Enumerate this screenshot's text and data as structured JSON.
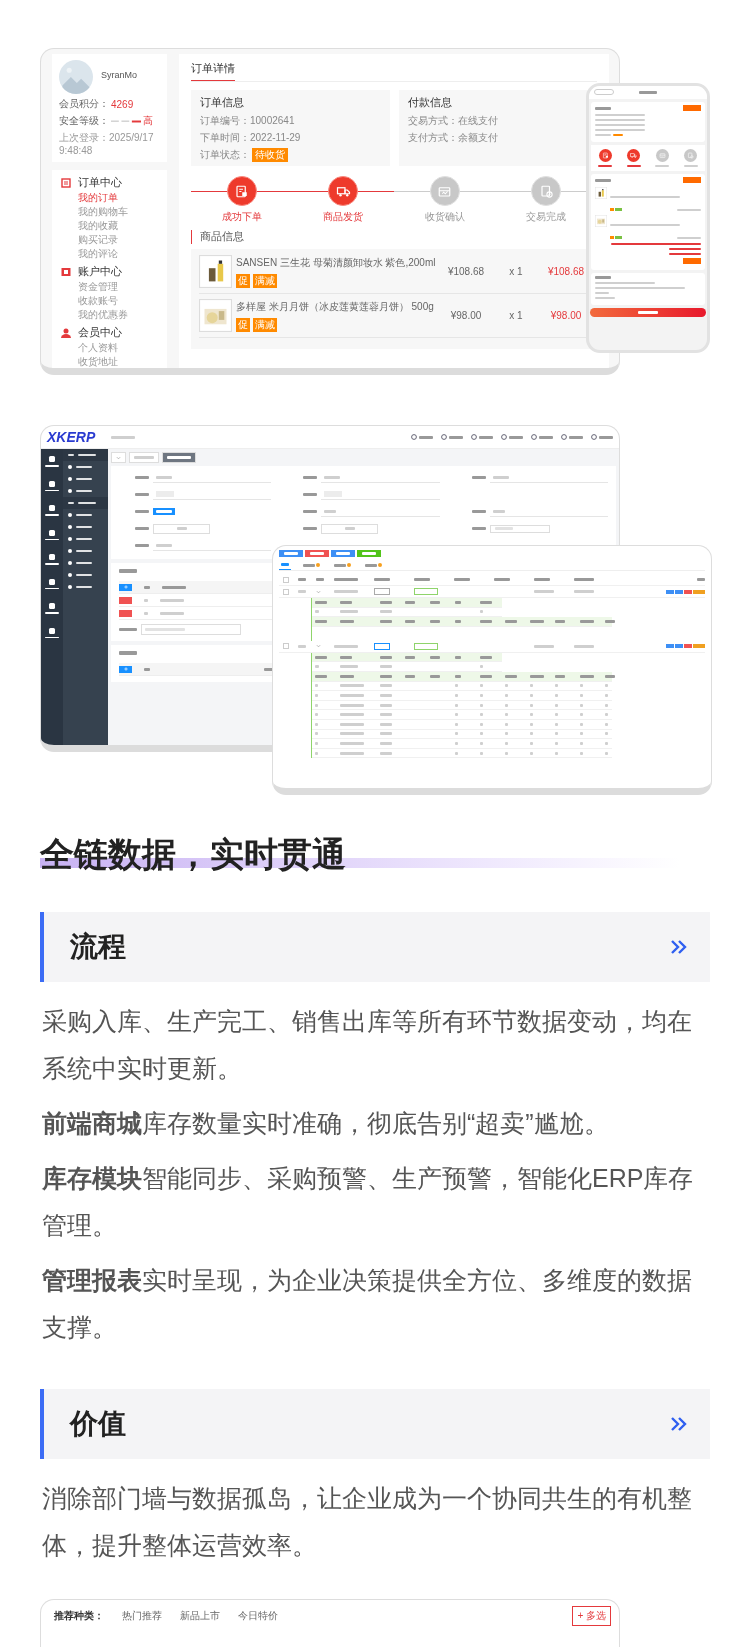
{
  "order_screen": {
    "user": {
      "name": "SyranMo",
      "points_label": "会员积分：",
      "points": "4269",
      "security_label": "安全等级：",
      "security_level": "高",
      "last_login": "上次登录：2025/9/17 9:48:48"
    },
    "menu": [
      {
        "title": "订单中心",
        "items": [
          {
            "label": "我的订单",
            "selected": true
          },
          {
            "label": "我的购物车",
            "selected": false
          },
          {
            "label": "我的收藏",
            "selected": false
          },
          {
            "label": "购买记录",
            "selected": false
          },
          {
            "label": "我的评论",
            "selected": false
          }
        ]
      },
      {
        "title": "账户中心",
        "items": [
          {
            "label": "资金管理",
            "selected": false
          },
          {
            "label": "收款账号",
            "selected": false
          },
          {
            "label": "我的优惠券",
            "selected": false
          }
        ]
      },
      {
        "title": "会员中心",
        "items": [
          {
            "label": "个人资料",
            "selected": false
          },
          {
            "label": "收货地址",
            "selected": false
          }
        ]
      }
    ],
    "tab": "订单详情",
    "order_info": {
      "title": "订单信息",
      "lines": [
        "订单编号：10002641",
        "下单时间：2022-11-29"
      ],
      "status_label": "订单状态：",
      "status": "待收货"
    },
    "payment_info": {
      "title": "付款信息",
      "lines": [
        "交易方式：在线支付",
        "支付方式：余额支付"
      ]
    },
    "steps": [
      {
        "label": "成功下单",
        "done": true
      },
      {
        "label": "商品发货",
        "done": true
      },
      {
        "label": "收货确认",
        "done": false
      },
      {
        "label": "交易完成",
        "done": false
      }
    ],
    "goods_title": "商品信息",
    "goods": [
      {
        "name": "SANSEN 三生花 母菊清颜卸妆水 紫色,200ml",
        "tags": [
          "促",
          "满减"
        ],
        "price": "¥108.68",
        "qty": "x 1",
        "total": "¥108.68"
      },
      {
        "name": "多样屋 米月月饼（冰皮莲黄莲蓉月饼） 500g",
        "tags": [
          "促",
          "满减"
        ],
        "price": "¥98.00",
        "qty": "x 1",
        "total": "¥98.00"
      }
    ]
  },
  "mobile_screen": {
    "steps": [
      {
        "done": true
      },
      {
        "done": true
      },
      {
        "done": false
      },
      {
        "done": false
      }
    ]
  },
  "erp_screen": {
    "logo": "XKERP",
    "menu": [
      {
        "kind": "group"
      },
      {
        "kind": "item"
      },
      {
        "kind": "item"
      },
      {
        "kind": "item"
      },
      {
        "kind": "group"
      },
      {
        "kind": "item"
      },
      {
        "kind": "item"
      },
      {
        "kind": "item"
      },
      {
        "kind": "item"
      },
      {
        "kind": "item"
      },
      {
        "kind": "item"
      },
      {
        "kind": "item"
      }
    ],
    "tabs": [
      {
        "selected": false
      },
      {
        "selected": true
      }
    ]
  },
  "orders_screen": {
    "buttons": [
      {
        "color": "#3d8ff5"
      },
      {
        "color": "#f05252"
      },
      {
        "color": "#3d8ff5"
      },
      {
        "color": "#52c41a"
      }
    ],
    "tabs": [
      {
        "selected": true,
        "badge": false
      },
      {
        "selected": false,
        "badge": true
      },
      {
        "selected": false,
        "badge": true
      },
      {
        "selected": false,
        "badge": true
      }
    ],
    "all_checked": false,
    "rows": [
      {
        "checked": false,
        "expanded": true
      },
      {
        "checked": false,
        "expanded": true
      }
    ]
  },
  "headline": "全链数据，实时贯通",
  "sections": [
    {
      "title": "流程",
      "paragraphs": [
        "采购入库、生产完工、销售出库等所有环节数据变动，均在系统中实时更新。",
        "**前端商城**库存数量实时准确，彻底告别“超卖”尴尬。",
        "**库存模块**智能同步、采购预警、生产预警，智能化ERP库存管理。",
        "**管理报表**实时呈现，为企业决策提供全方位、多维度的数据支撑。"
      ]
    },
    {
      "title": "价值",
      "paragraphs": [
        "消除部门墙与数据孤岛，让企业成为一个协同共生的有机整体，提升整体运营效率。"
      ]
    }
  ],
  "shop_screen": {
    "label": "推荐种类：",
    "options": [
      "热门推荐",
      "新品上市",
      "今日特价"
    ],
    "button": "+ 多选"
  }
}
